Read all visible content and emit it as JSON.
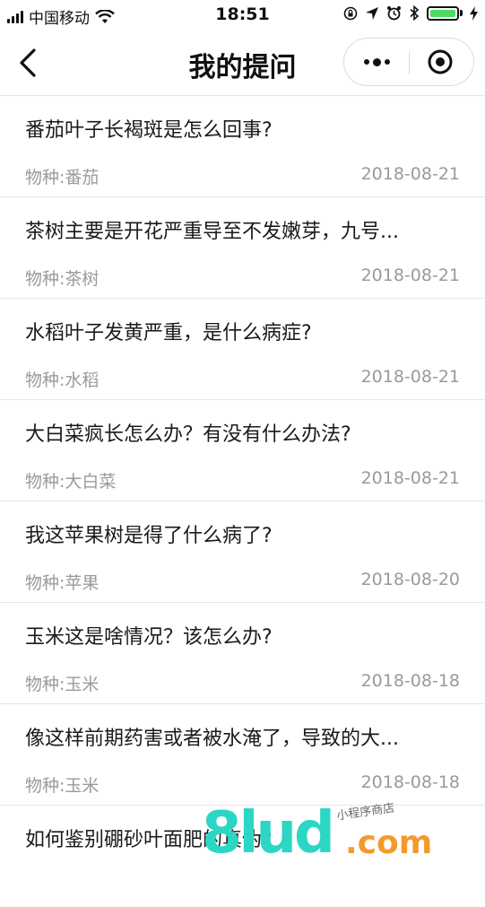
{
  "status_bar": {
    "carrier": "中国移动",
    "time": "18:51"
  },
  "nav": {
    "title": "我的提问"
  },
  "questions": [
    {
      "title": "番茄叶子长褐斑是怎么回事?",
      "species": "物种:番茄",
      "date": "2018-08-21"
    },
    {
      "title": "茶树主要是开花严重导至不发嫩芽，九号...",
      "species": "物种:茶树",
      "date": "2018-08-21"
    },
    {
      "title": "水稻叶子发黄严重，是什么病症?",
      "species": "物种:水稻",
      "date": "2018-08-21"
    },
    {
      "title": "大白菜疯长怎么办？有没有什么办法?",
      "species": "物种:大白菜",
      "date": "2018-08-21"
    },
    {
      "title": "我这苹果树是得了什么病了?",
      "species": "物种:苹果",
      "date": "2018-08-20"
    },
    {
      "title": "玉米这是啥情况？该怎么办?",
      "species": "物种:玉米",
      "date": "2018-08-18"
    },
    {
      "title": "像这样前期药害或者被水淹了，导致的大...",
      "species": "物种:玉米",
      "date": "2018-08-18"
    },
    {
      "title": "如何鉴别硼砂叶面肥的真伪?",
      "species": "",
      "date": ""
    }
  ],
  "watermark": {
    "brand": "8lud",
    "tld": ".com",
    "tagline": "小程序商店"
  },
  "colors": {
    "battery": "#4cd964",
    "secondary_text": "#9a9a9a",
    "watermark_teal": "#2bd6c4",
    "watermark_orange": "#f39a2c"
  }
}
